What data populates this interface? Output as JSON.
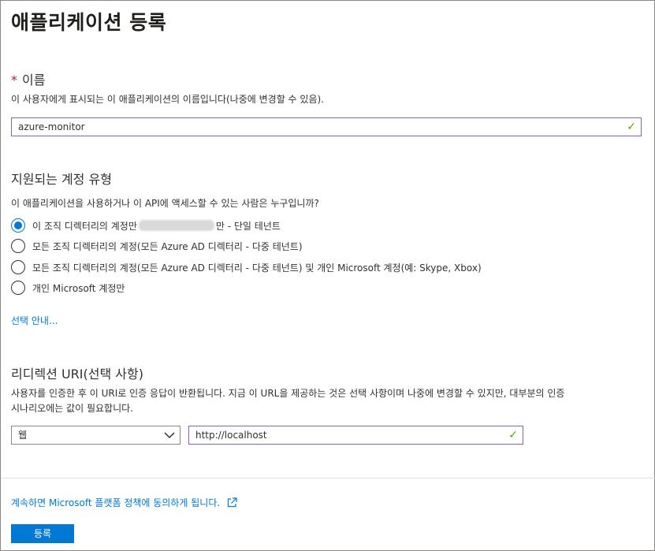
{
  "page": {
    "title": "애플리케이션 등록"
  },
  "name_section": {
    "required_marker": "*",
    "label": "이름",
    "description": "이 사용자에게 표시되는 이 애플리케이션의 이름입니다(나중에 변경할 수 있음).",
    "input_value": "azure-monitor"
  },
  "account_types": {
    "title": "지원되는 계정 유형",
    "question": "이 애플리케이션을 사용하거나 이 API에 액세스할 수 있는 사람은 누구입니까?",
    "options": [
      {
        "label_before": "이 조직 디렉터리의 계정만",
        "label_after": "만 - 단일 테넌트",
        "selected": true
      },
      {
        "label": "모든 조직 디렉터리의 계정(모든 Azure AD 디렉터리 - 다중 테넌트)",
        "selected": false
      },
      {
        "label": "모든 조직 디렉터리의 계정(모든 Azure AD 디렉터리 - 다중 테넌트) 및 개인 Microsoft 계정(예: Skype, Xbox)",
        "selected": false
      },
      {
        "label": "개인 Microsoft 계정만",
        "selected": false
      }
    ],
    "help_link": "선택 안내..."
  },
  "redirect": {
    "title": "리디렉션 URI(선택 사항)",
    "description_line1": "사용자를 인증한 후 이 URI로 인증 응답이 반환됩니다. 지금 이 URL을 제공하는 것은 선택 사항이며 나중에 변경할 수 있지만, 대부분의 인증",
    "description_line2": "시나리오에는 값이 필요합니다.",
    "platform_selected": "웹",
    "uri_value": "http://localhost"
  },
  "footer": {
    "policy_text": "계속하면 Microsoft 플랫폼 정책에 동의하게 됩니다.",
    "register_label": "등록"
  },
  "colors": {
    "accent": "#0078d4",
    "focus_border": "#8764b8",
    "valid_check": "#57a300",
    "required": "#a4262c"
  }
}
